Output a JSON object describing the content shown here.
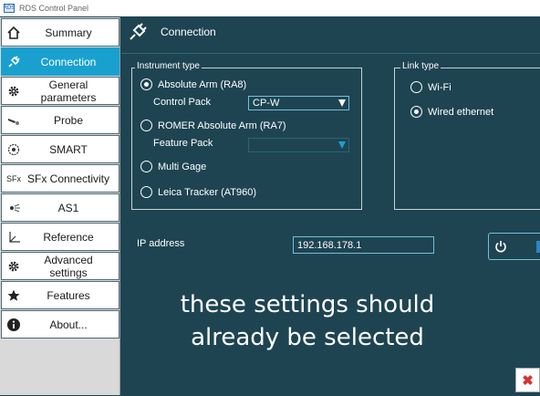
{
  "window": {
    "title": "RDS Control Panel",
    "icon_text": "RDS"
  },
  "sidebar": {
    "items": [
      {
        "label": "Summary",
        "icon": "home-icon"
      },
      {
        "label": "Connection",
        "icon": "plug-icon",
        "active": true
      },
      {
        "label": "General parameters",
        "icon": "gear-icon"
      },
      {
        "label": "Probe",
        "icon": "probe-icon"
      },
      {
        "label": "SMART",
        "icon": "smart-icon"
      },
      {
        "label": "SFx Connectivity",
        "icon": "sfx-icon",
        "icon_text": "SFx"
      },
      {
        "label": "AS1",
        "icon": "scanner-icon"
      },
      {
        "label": "Reference",
        "icon": "axes-icon"
      },
      {
        "label": "Advanced settings",
        "icon": "gear-icon"
      },
      {
        "label": "Features",
        "icon": "star-icon"
      },
      {
        "label": "About...",
        "icon": "info-icon"
      }
    ]
  },
  "header": {
    "title": "Connection",
    "icon": "plug-icon"
  },
  "instrument": {
    "legend": "Instrument type",
    "options": [
      "Absolute Arm (RA8)",
      "ROMER Absolute Arm (RA7)",
      "Multi Gage",
      "Leica Tracker (AT960)"
    ],
    "selected_index": 0,
    "control_pack_label": "Control Pack",
    "control_pack_value": "CP-W",
    "feature_pack_label": "Feature Pack",
    "feature_pack_value": ""
  },
  "link": {
    "legend": "Link type",
    "options": [
      "Wi-Fi",
      "Wired ethernet"
    ],
    "selected_index": 1
  },
  "ip": {
    "label": "IP address",
    "value": "192.168.178.1"
  },
  "overlay_text": {
    "line1": "these settings should",
    "line2": "already be selected"
  },
  "colors": {
    "background": "#1e4452",
    "accent": "#1aa0cf",
    "close": "#d8322c"
  }
}
